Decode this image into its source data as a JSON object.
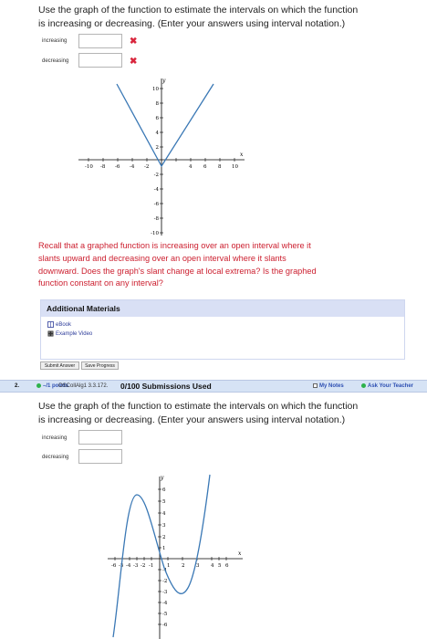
{
  "question1": {
    "prompt_line1": "Use the graph of the function to estimate the intervals on which the function",
    "prompt_line2": "is increasing or decreasing. (Enter your answers using interval notation.)",
    "increasing_label": "increasing",
    "decreasing_label": "decreasing",
    "increasing_value": "",
    "decreasing_value": "",
    "incorrect_mark": "✖",
    "graph": {
      "x_axis_label": "x",
      "y_axis_label": "y",
      "x_ticks": [
        "-10",
        "-8",
        "-6",
        "-4",
        "-2",
        "4",
        "6",
        "8",
        "10"
      ],
      "y_ticks": [
        "10",
        "8",
        "6",
        "4",
        "2",
        "-2",
        "-4",
        "-6",
        "-8",
        "-10"
      ]
    },
    "hint_line1": "Recall that a graphed function is increasing over an open interval where it",
    "hint_line2": "slants upward and decreasing over an open interval where it slants",
    "hint_line3": "downward. Does the graph's slant change at local extrema? Is the graphed",
    "hint_line4": "function constant on any interval?",
    "additional_materials": {
      "title": "Additional Materials",
      "items": [
        "eBook",
        "Example Video"
      ]
    },
    "buttons": {
      "submit": "Submit Answer",
      "save": "Save Progress"
    }
  },
  "question2": {
    "number": "2.",
    "points": "–/1 points",
    "course": "OSCollAlg1 3.3.172.",
    "submissions": "0/100 Submissions Used",
    "my_notes": "My Notes",
    "ask_teacher": "Ask Your Teacher",
    "prompt_line1": "Use the graph of the function to estimate the intervals on which the function",
    "prompt_line2": "is increasing or decreasing. (Enter your answers using interval notation.)",
    "increasing_label": "increasing",
    "decreasing_label": "decreasing",
    "increasing_value": "",
    "decreasing_value": "",
    "graph": {
      "x_axis_label": "x",
      "y_axis_label": "y",
      "x_ticks_neg": [
        "-6",
        "-5",
        "-4",
        "-3",
        "-2",
        "-1"
      ],
      "x_ticks_pos": [
        "1",
        "2",
        "3",
        "4",
        "5",
        "6"
      ],
      "y_ticks": [
        "6",
        "5",
        "4",
        "3",
        "2",
        "1",
        "-1",
        "-2",
        "-3",
        "-4",
        "-5",
        "-6"
      ]
    }
  },
  "colors": {
    "hint_red": "#cc1f2f",
    "header_blue": "#d6e3f5",
    "link_blue": "#2d3c9a",
    "graph_blue": "#3a78b5"
  }
}
